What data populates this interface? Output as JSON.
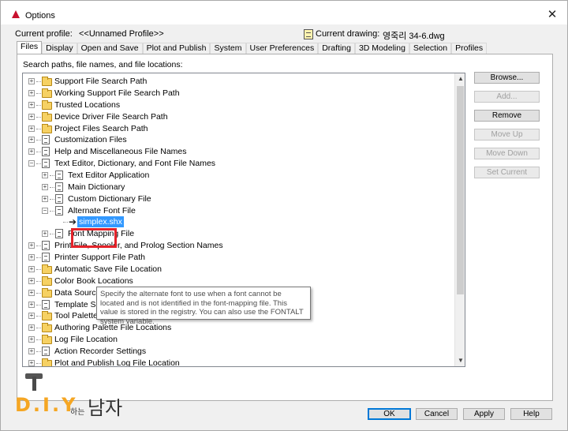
{
  "window": {
    "title": "Options",
    "close_glyph": "✕"
  },
  "profile": {
    "label": "Current profile:",
    "value": "<<Unnamed Profile>>",
    "drawing_label": "Current drawing:",
    "drawing_value": "영죽리 34-6.dwg"
  },
  "tabs": [
    {
      "label": "Files",
      "active": true
    },
    {
      "label": "Display"
    },
    {
      "label": "Open and Save"
    },
    {
      "label": "Plot and Publish"
    },
    {
      "label": "System"
    },
    {
      "label": "User Preferences"
    },
    {
      "label": "Drafting"
    },
    {
      "label": "3D Modeling"
    },
    {
      "label": "Selection"
    },
    {
      "label": "Profiles"
    }
  ],
  "panel": {
    "caption": "Search paths, file names, and file locations:"
  },
  "tree": {
    "items": [
      {
        "label": "Support File Search Path",
        "icon": "folder-icon",
        "expander": "+"
      },
      {
        "label": "Working Support File Search Path",
        "icon": "folder-icon",
        "expander": "+"
      },
      {
        "label": "Trusted Locations",
        "icon": "folder-icon",
        "expander": "+"
      },
      {
        "label": "Device Driver File Search Path",
        "icon": "folder-icon",
        "expander": "+"
      },
      {
        "label": "Project Files Search Path",
        "icon": "folder-icon",
        "expander": "+"
      },
      {
        "label": "Customization Files",
        "icon": "doc-icon",
        "expander": "+"
      },
      {
        "label": "Help and Miscellaneous File Names",
        "icon": "doc-icon",
        "expander": "+"
      },
      {
        "label": "Text Editor, Dictionary, and Font File Names",
        "icon": "doc-icon",
        "expander": "−"
      },
      {
        "label": "Text Editor Application",
        "icon": "doc-icon",
        "expander": "+"
      },
      {
        "label": "Main Dictionary",
        "icon": "doc-icon",
        "expander": "+"
      },
      {
        "label": "Custom Dictionary File",
        "icon": "doc-icon",
        "expander": "+"
      },
      {
        "label": "Alternate Font File",
        "icon": "doc-icon",
        "expander": "−"
      },
      {
        "label": "simplex.shx",
        "icon": "arrow-icon"
      },
      {
        "label": "Font Mapping File",
        "icon": "doc-icon",
        "expander": "+"
      },
      {
        "label": "Print File, Spooler, and Prolog Section Names",
        "icon": "doc-icon",
        "expander": "+"
      },
      {
        "label": "Printer Support File Path",
        "icon": "doc-icon",
        "expander": "+"
      },
      {
        "label": "Automatic Save File Location",
        "icon": "folder-icon",
        "expander": "+"
      },
      {
        "label": "Color Book Locations",
        "icon": "folder-icon",
        "expander": "+"
      },
      {
        "label": "Data Sources Location",
        "icon": "folder-icon",
        "expander": "+"
      },
      {
        "label": "Template Settings",
        "icon": "doc-icon",
        "expander": "+"
      },
      {
        "label": "Tool Palettes File Locations",
        "icon": "folder-icon",
        "expander": "+"
      },
      {
        "label": "Authoring Palette File Locations",
        "icon": "folder-icon",
        "expander": "+"
      },
      {
        "label": "Log File Location",
        "icon": "folder-icon",
        "expander": "+"
      },
      {
        "label": "Action Recorder Settings",
        "icon": "doc-icon",
        "expander": "+"
      },
      {
        "label": "Plot and Publish Log File Location",
        "icon": "folder-icon",
        "expander": "+"
      }
    ]
  },
  "tooltip": {
    "text": "Specify the alternate font to use when a font cannot be located and is not identified in the font-mapping file. This value is stored in the registry. You can also use the FONTALT system variable."
  },
  "side_buttons": {
    "browse": "Browse...",
    "add": "Add...",
    "remove": "Remove",
    "move_up": "Move Up",
    "move_down": "Move Down",
    "set_current": "Set Current"
  },
  "bottom_buttons": {
    "ok": "OK",
    "cancel": "Cancel",
    "apply": "Apply",
    "help": "Help"
  },
  "watermark": {
    "diy": "D.I.Y",
    "small": "하는",
    "big": "남자"
  }
}
